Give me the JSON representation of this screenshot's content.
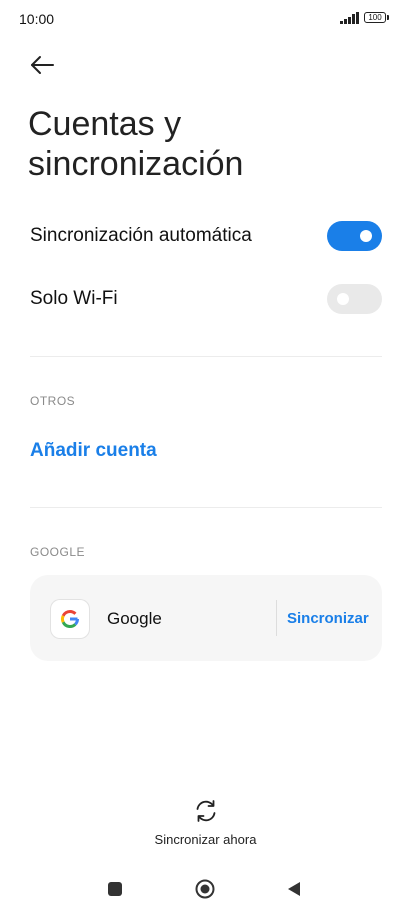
{
  "status_bar": {
    "time": "10:00",
    "battery": "100",
    "icons": [
      "signal-icon",
      "battery-icon"
    ]
  },
  "header": {
    "back_icon": "arrow-left-icon",
    "title": "Cuentas y sincronización"
  },
  "settings": {
    "auto_sync": {
      "label": "Sincronización automática",
      "enabled": true
    },
    "wifi_only": {
      "label": "Solo Wi-Fi",
      "enabled": false
    }
  },
  "others_section": {
    "header": "OTROS",
    "add_account_label": "Añadir cuenta"
  },
  "google_section": {
    "header": "GOOGLE",
    "account": {
      "icon": "google-logo-icon",
      "name": "Google",
      "sync_label": "Sincronizar"
    }
  },
  "footer": {
    "sync_now_icon": "sync-icon",
    "sync_now_label": "Sincronizar ahora"
  },
  "nav_bar": {
    "icons": [
      "recent-apps-icon",
      "home-icon",
      "back-triangle-icon"
    ]
  },
  "colors": {
    "accent": "#1a7fe8",
    "toggle_off": "#e9e9e9",
    "card_bg": "#f6f6f6"
  }
}
